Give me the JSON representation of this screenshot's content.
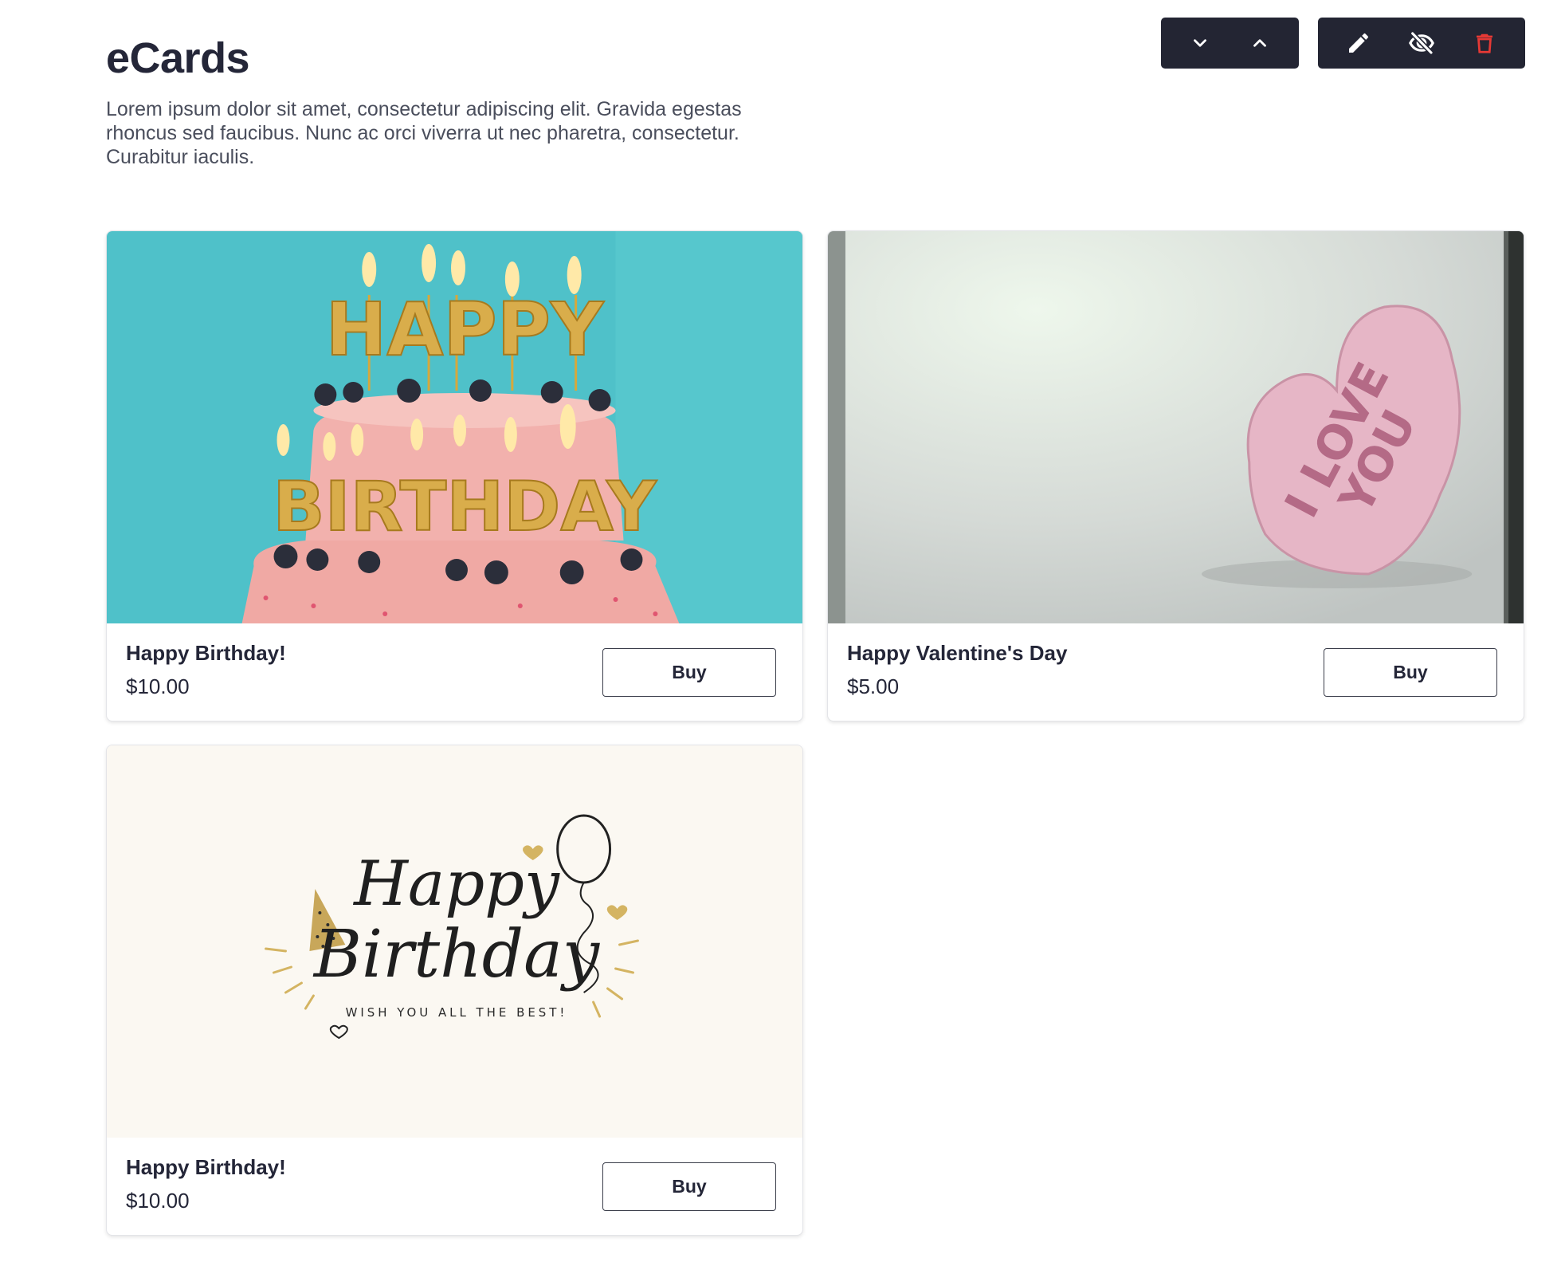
{
  "header": {
    "title": "eCards",
    "description": "Lorem ipsum dolor sit amet, consectetur adipiscing elit. Gravida egestas rhoncus sed faucibus. Nunc ac orci viverra ut nec pharetra, consectetur. Curabitur iaculis."
  },
  "toolbar": {
    "move": [
      {
        "icon": "chevron-down-icon"
      },
      {
        "icon": "chevron-up-icon"
      }
    ],
    "actions": [
      {
        "icon": "pencil-icon"
      },
      {
        "icon": "eye-off-icon"
      },
      {
        "icon": "trash-icon",
        "color": "#e53935"
      }
    ]
  },
  "cards": [
    {
      "image": {
        "text_top": "HAPPY",
        "text_bottom": "BIRTHDAY",
        "background": "#4fc1c9"
      },
      "title": "Happy Birthday!",
      "price": "$10.00",
      "buy_label": "Buy"
    },
    {
      "image": {
        "text_top": "I LOVE",
        "text_bottom": "YOU",
        "background": "#dfe4df"
      },
      "title": "Happy Valentine's Day",
      "price": "$5.00",
      "buy_label": "Buy"
    },
    {
      "image": {
        "text_top": "Happy",
        "text_bottom": "Birthday",
        "caption": "WISH YOU ALL THE BEST!",
        "background": "#fbf8f2"
      },
      "title": "Happy Birthday!",
      "price": "$10.00",
      "buy_label": "Buy"
    }
  ],
  "colors": {
    "toolbar_bg": "#232533",
    "text_primary": "#242638",
    "delete_red": "#e53935"
  }
}
